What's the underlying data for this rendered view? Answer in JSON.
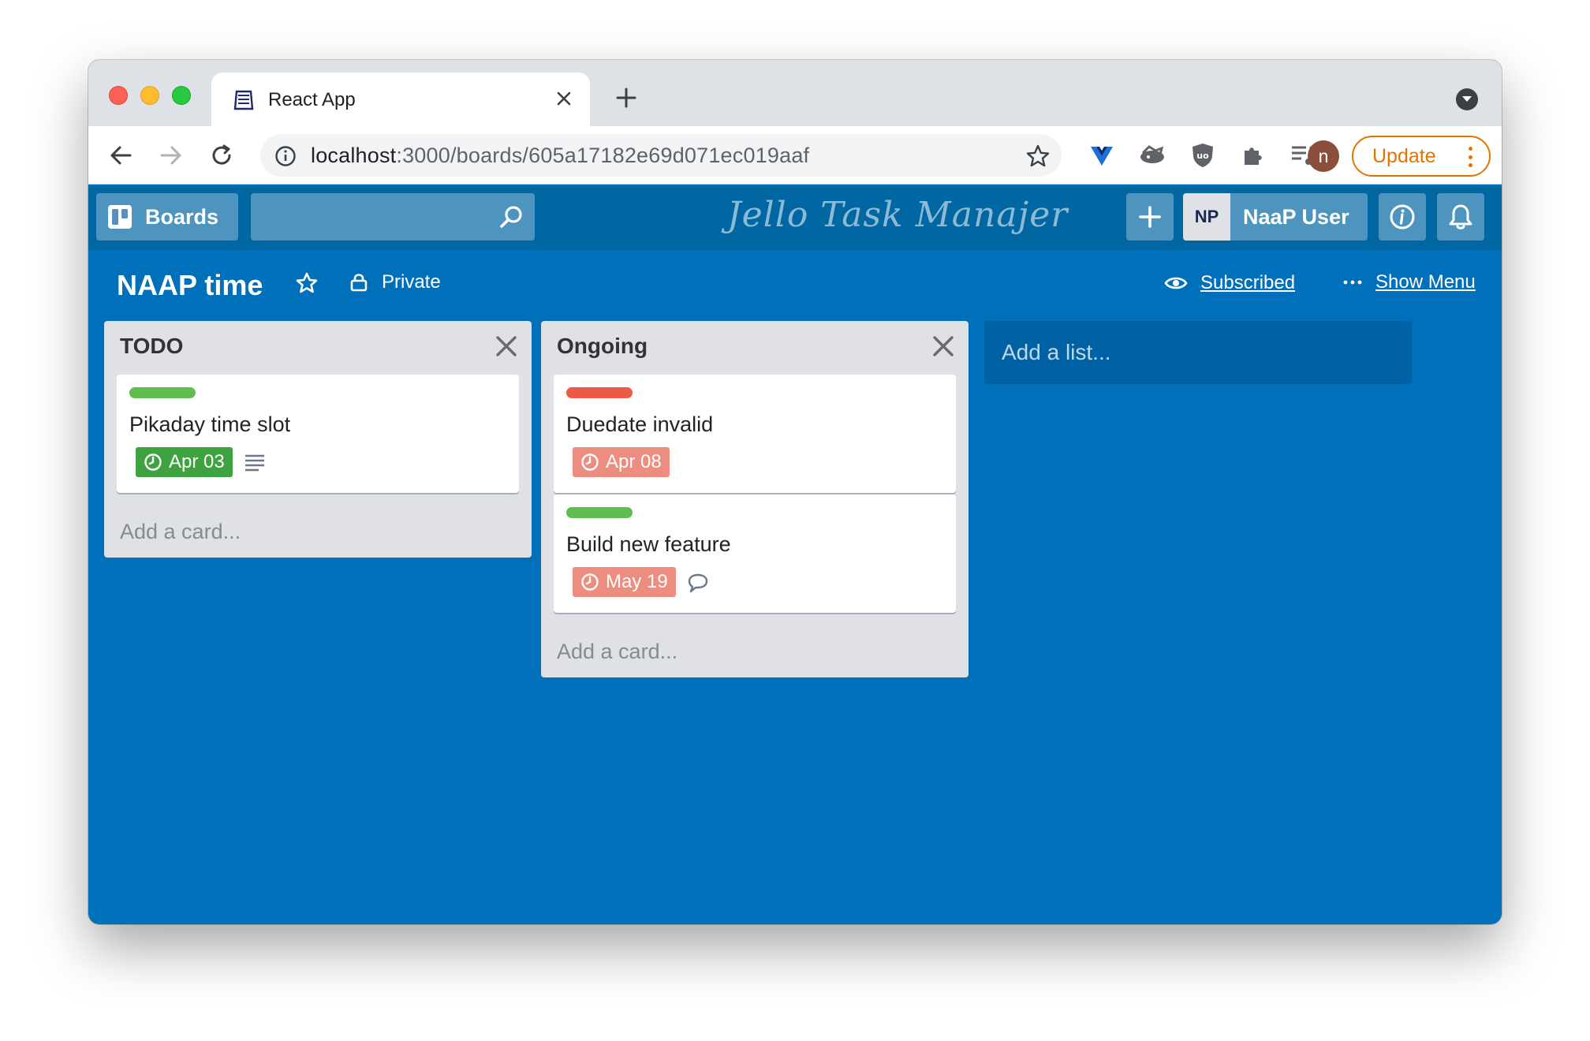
{
  "browser": {
    "tab": {
      "title": "React App"
    },
    "omnibox": {
      "host": "localhost",
      "path": ":3000/boards/605a17182e69d071ec019aaf"
    },
    "profile_initial": "n",
    "update_label": "Update"
  },
  "header": {
    "boards_label": "Boards",
    "brand": "Jello Task Manajer",
    "user_initials": "NP",
    "user_name": "NaaP User"
  },
  "board": {
    "title": "NAAP time",
    "privacy": "Private",
    "subscribed": "Subscribed",
    "show_menu": "Show Menu"
  },
  "lists": [
    {
      "title": "TODO",
      "cards": [
        {
          "label_color": "#61bd4f",
          "title": "Pikaday time slot",
          "due": "Apr 03",
          "due_color": "#3da23f",
          "extra_icon": "description-icon"
        }
      ],
      "add_card": "Add a card..."
    },
    {
      "title": "Ongoing",
      "cards": [
        {
          "label_color": "#eb5a46",
          "title": "Duedate invalid",
          "due": "Apr 08",
          "due_color": "#ec8d80",
          "extra_icon": ""
        },
        {
          "label_color": "#61bd4f",
          "title": "Build new feature",
          "due": "May 19",
          "due_color": "#ec8d80",
          "extra_icon": "comment-icon"
        }
      ],
      "add_card": "Add a card..."
    }
  ],
  "add_list": "Add a list...",
  "colors": {
    "board_bg": "#0070bb",
    "header_bg": "#0067a3",
    "list_bg": "#dfe1e6",
    "update_orange": "#e37400"
  }
}
